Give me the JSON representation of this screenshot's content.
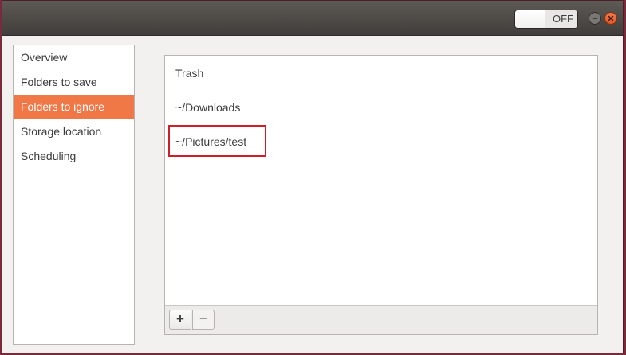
{
  "titlebar": {
    "toggle_state": "OFF",
    "minimize_icon": "minus-icon",
    "close_icon": "close-icon"
  },
  "sidebar": {
    "items": [
      {
        "label": "Overview",
        "selected": false
      },
      {
        "label": "Folders to save",
        "selected": false
      },
      {
        "label": "Folders to ignore",
        "selected": true
      },
      {
        "label": "Storage location",
        "selected": false
      },
      {
        "label": "Scheduling",
        "selected": false
      }
    ]
  },
  "folders": {
    "items": [
      {
        "label": "Trash"
      },
      {
        "label": "~/Downloads"
      },
      {
        "label": "~/Pictures/test",
        "highlighted": true
      }
    ]
  },
  "toolbar": {
    "add_label": "+",
    "remove_label": "−"
  },
  "colors": {
    "accent": "#f07746",
    "highlight_border": "#d01f2a",
    "desktop_background": "#7a2a3a"
  }
}
